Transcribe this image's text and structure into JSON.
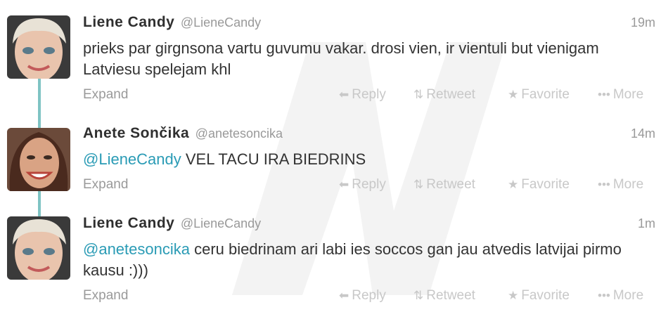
{
  "tweets": [
    {
      "name": "Liene Candy",
      "handle": "@LieneCandy",
      "time": "19m",
      "text": "prieks par girgnsona vartu guvumu vakar. drosi vien, ir vientuli but vienigam Latviesu spelejam khl"
    },
    {
      "name": "Anete Sončika",
      "handle": "@anetesoncika",
      "time": "14m",
      "mention": "@LieneCandy",
      "text": " VEL TACU IRA BIEDRINS"
    },
    {
      "name": "Liene Candy",
      "handle": "@LieneCandy",
      "time": "1m",
      "mention": "@anetesoncika",
      "text": " ceru biedrinam ari labi ies soccos gan jau atvedis latvijai pirmo kausu :)))"
    }
  ],
  "actions": {
    "expand": "Expand",
    "reply": "Reply",
    "retweet": "Retweet",
    "favorite": "Favorite",
    "more": "More"
  },
  "icons": {
    "reply": "reply-arrow-icon",
    "retweet": "retweet-icon",
    "favorite": "star-icon",
    "more": "dots-icon"
  },
  "colors": {
    "mention": "#2a9bb5",
    "connector": "#7fc4c4",
    "action": "#c8c8c8"
  }
}
